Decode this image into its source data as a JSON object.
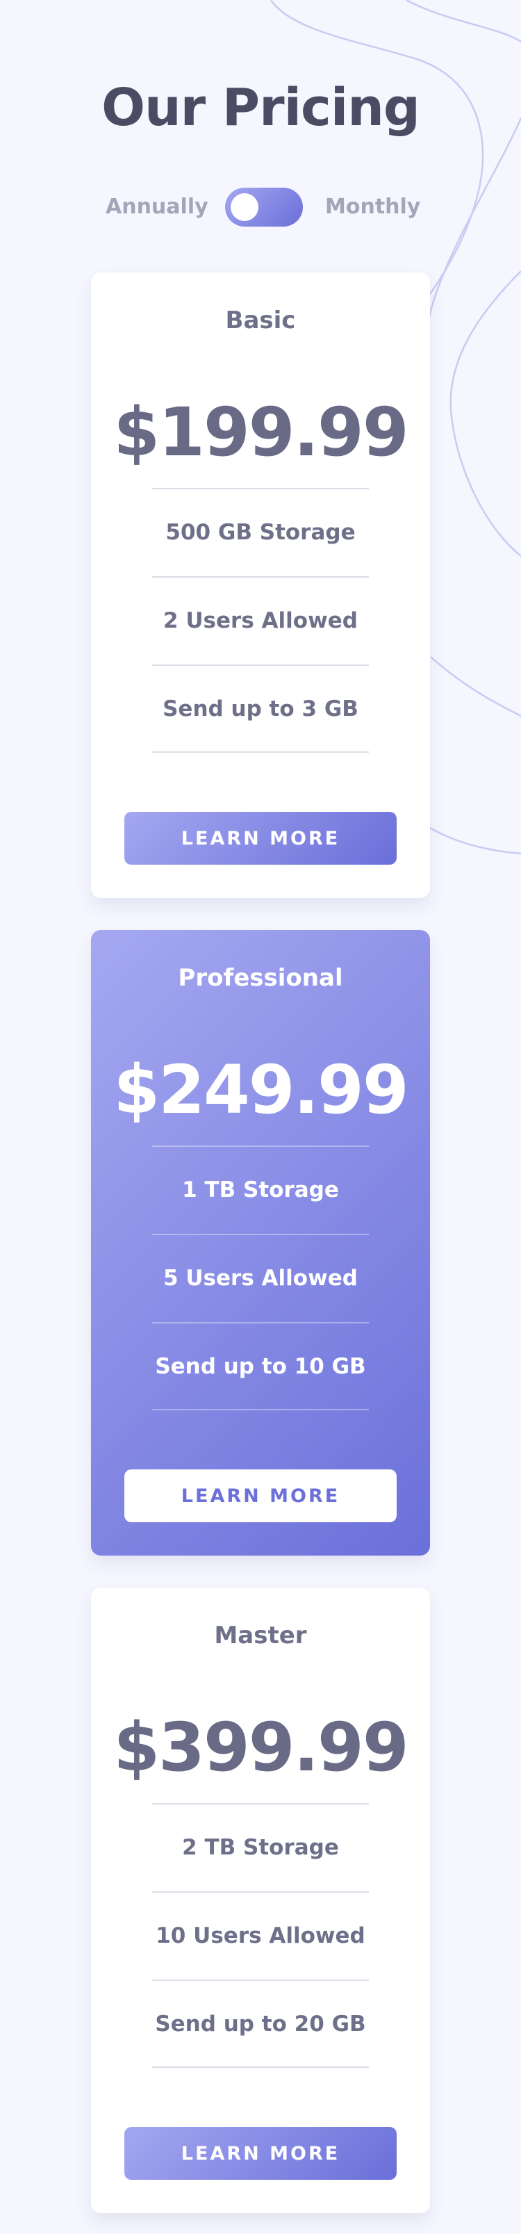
{
  "page": {
    "title": "Our Pricing",
    "background_color": "#f5f6fe",
    "accent_gradient": [
      "#a4a7f0",
      "#6a6fd9"
    ]
  },
  "billing_toggle": {
    "left_label": "Annually",
    "right_label": "Monthly",
    "selected": "Annually"
  },
  "plans": [
    {
      "name": "Basic",
      "price": "$199.99",
      "features": [
        "500 GB Storage",
        "2 Users Allowed",
        "Send up to 3 GB"
      ],
      "button_label": "LEARN MORE",
      "highlighted": false
    },
    {
      "name": "Professional",
      "price": "$249.99",
      "features": [
        "1 TB Storage",
        "5 Users Allowed",
        "Send up to 10 GB"
      ],
      "button_label": "LEARN MORE",
      "highlighted": true
    },
    {
      "name": "Master",
      "price": "$399.99",
      "features": [
        "2 TB Storage",
        "10 Users Allowed",
        "Send up to 20 GB"
      ],
      "button_label": "LEARN MORE",
      "highlighted": false
    }
  ]
}
